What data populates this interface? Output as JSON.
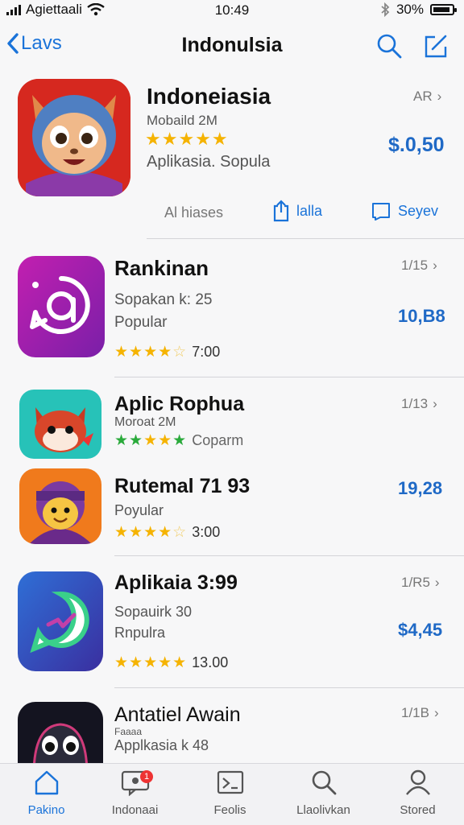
{
  "status_bar": {
    "carrier": "Agiettaali",
    "time": "10:49",
    "battery": "30%"
  },
  "nav": {
    "back_label": "Lavs",
    "title": "Indonulsia"
  },
  "featured": {
    "title": "Indoneiasia",
    "subtitle": "Mobaild 2M",
    "stars": 5,
    "category": "Aplikasia. Sopula",
    "rank": "AR",
    "price": "$.0,50",
    "actions": {
      "all": "Al hiases",
      "share": "lalla",
      "review": "Seyev"
    }
  },
  "apps": [
    {
      "title": "Rankinan",
      "line1": "Sopakan k: 25",
      "line2": "Popular",
      "stars": 4.5,
      "rating": "7:00",
      "rank": "1/15",
      "price": "10,B8"
    },
    {
      "title": "Aplic Rophua",
      "line1": "Moroat 2M",
      "stars": 5,
      "rating": "Coparm",
      "rank": "1/13",
      "star_color": "#2aaa3b"
    },
    {
      "title": "Rutemal 71 93",
      "line1": "Poyular",
      "stars": 4.5,
      "rating": "3:00",
      "price": "19,28"
    },
    {
      "title": "Aplikaia 3:99",
      "line1": "Sopauirk 30",
      "line2": "Rnpulra",
      "stars": 5,
      "rating": "13.00",
      "rank": "1/R5",
      "price": "$4,45"
    },
    {
      "title": "Antatiel Awain",
      "line0": "Faaaa",
      "line1": "Applkasia k 48",
      "rank": "1/1B"
    }
  ],
  "tabs": [
    {
      "label": "Pakino",
      "icon": "home-icon",
      "active": true
    },
    {
      "label": "Indonaai",
      "icon": "messages-icon",
      "badge": "1"
    },
    {
      "label": "Feolis",
      "icon": "apps-icon"
    },
    {
      "label": "Llaolivkan",
      "icon": "search-icon"
    },
    {
      "label": "Stored",
      "icon": "person-icon"
    }
  ],
  "colors": {
    "accent": "#1a73d9",
    "price": "#1f69c6",
    "star": "#f5b301"
  }
}
